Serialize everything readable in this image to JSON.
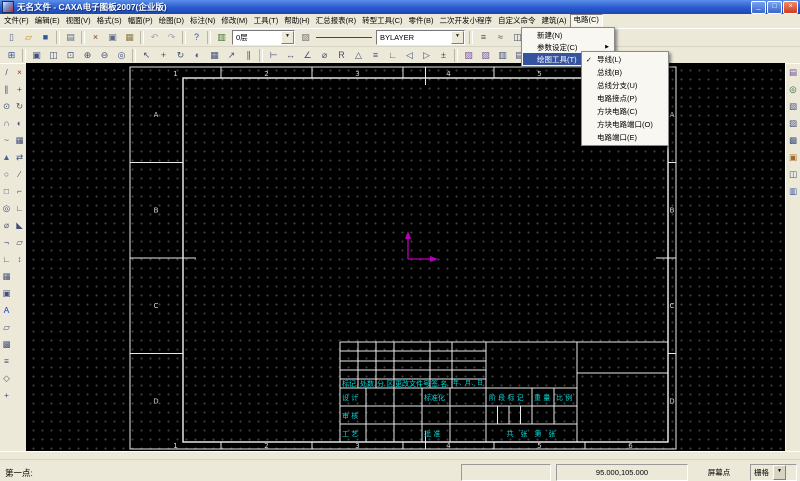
{
  "window": {
    "title": "无名文件 - CAXA电子图板2007(企业版)",
    "controls": [
      {
        "n": "minimize-button",
        "g": "_"
      },
      {
        "n": "maximize-button",
        "g": "□"
      },
      {
        "n": "close-button",
        "g": "×"
      }
    ]
  },
  "menubar": {
    "items": [
      "文件(F)",
      "编辑(E)",
      "视图(V)",
      "格式(S)",
      "幅面(P)",
      "绘图(D)",
      "标注(N)",
      "修改(M)",
      "工具(T)",
      "帮助(H)",
      "汇总报表(R)",
      "转型工具(C)",
      "零件(B)",
      "二次开发小程序",
      "自定义命令",
      "建筑(A)",
      "电路(C)"
    ],
    "open_index": 16
  },
  "toolbar1": {
    "layer_value": "0层",
    "linetype_value": "BYLAYER"
  },
  "icons": {
    "main_a": [
      {
        "n": "new-file-icon",
        "g": "▯",
        "c": "#5a6b8c"
      },
      {
        "n": "open-file-icon",
        "g": "▱",
        "c": "#c09018"
      },
      {
        "n": "save-icon",
        "g": "■",
        "c": "#34549c"
      },
      {
        "sep": true
      },
      {
        "n": "print-icon",
        "g": "▤",
        "c": "#5a6b8c"
      },
      {
        "sep": true
      },
      {
        "n": "cut-icon",
        "g": "×",
        "c": "#8c3030"
      },
      {
        "n": "copy-icon",
        "g": "▣",
        "c": "#5a6b8c"
      },
      {
        "n": "paste-icon",
        "g": "▦",
        "c": "#8a7b4a"
      },
      {
        "sep": true
      },
      {
        "n": "undo-icon",
        "g": "↶",
        "c": "#a0a4b0"
      },
      {
        "n": "redo-icon",
        "g": "↷",
        "c": "#a0a4b0"
      },
      {
        "sep": true
      },
      {
        "n": "help-icon",
        "g": "?",
        "c": "#2a52be"
      },
      {
        "sep": true
      },
      {
        "n": "layer-manager-icon",
        "g": "▥",
        "c": "#44702e"
      }
    ],
    "main_b": [
      {
        "sep": true
      },
      {
        "n": "linewidth-icon",
        "g": "≡",
        "c": "#445066"
      },
      {
        "n": "linetype-load-icon",
        "g": "≈",
        "c": "#445066"
      },
      {
        "n": "block-tool-icon",
        "g": "◫",
        "c": "#445066"
      },
      {
        "n": "image-insert-icon",
        "g": "▧",
        "c": "#c07820"
      }
    ],
    "standard2": [
      {
        "n": "frame-settings-icon",
        "g": "⊞",
        "c": "#34549c"
      },
      {
        "sep": true
      },
      {
        "n": "zoom-window-icon",
        "g": "▣"
      },
      {
        "n": "zoom-prev-icon",
        "g": "◫"
      },
      {
        "n": "zoom-all-icon",
        "g": "⊡"
      },
      {
        "n": "zoom-in-icon",
        "g": "⊕"
      },
      {
        "n": "zoom-out-icon",
        "g": "⊖"
      },
      {
        "n": "redraw-icon",
        "g": "◎"
      },
      {
        "sep": true
      },
      {
        "n": "pick-icon",
        "g": "↖"
      },
      {
        "n": "move-icon",
        "g": "+"
      },
      {
        "n": "rotate-icon",
        "g": "↻"
      },
      {
        "n": "mirror-icon",
        "g": "◐"
      },
      {
        "n": "array-icon",
        "g": "▦"
      },
      {
        "n": "scale-icon",
        "g": "↗"
      },
      {
        "n": "offset-icon",
        "g": "∥"
      },
      {
        "sep": true
      },
      {
        "n": "dim-linear-icon",
        "g": "⊢"
      },
      {
        "n": "dim-horizontal-icon",
        "g": "↔"
      },
      {
        "n": "dim-angle-icon",
        "g": "∠"
      },
      {
        "n": "dim-diameter-icon",
        "g": "⌀"
      },
      {
        "n": "dim-radius-icon",
        "g": "R"
      },
      {
        "n": "tolerance-icon",
        "g": "△"
      },
      {
        "n": "text-style-icon",
        "g": "≡"
      },
      {
        "n": "leader-icon",
        "g": "∟"
      },
      {
        "n": "datum-left-icon",
        "g": "◁"
      },
      {
        "n": "datum-right-icon",
        "g": "▷"
      },
      {
        "n": "deviation-icon",
        "g": "±"
      },
      {
        "sep": true
      },
      {
        "n": "hatch-icon",
        "g": "▨",
        "c": "#7a5aa0"
      },
      {
        "n": "solid-fill-icon",
        "g": "▧",
        "c": "#7a5aa0"
      },
      {
        "n": "table-icon",
        "g": "▥"
      },
      {
        "n": "bom-icon",
        "g": "▤"
      },
      {
        "n": "block-insert-icon",
        "g": "◇"
      },
      {
        "n": "library-icon",
        "g": "▩",
        "c": "#a06a2a"
      },
      {
        "n": "ole-object-icon",
        "g": "▬",
        "c": "#a06a2a"
      }
    ],
    "draw": [
      {
        "n": "line-icon",
        "g": "/"
      },
      {
        "n": "parallel-line-icon",
        "g": "∥"
      },
      {
        "n": "circle-icon",
        "g": "⊙"
      },
      {
        "n": "arc-icon",
        "g": "∩"
      },
      {
        "n": "spline-icon",
        "g": "~"
      },
      {
        "n": "polygon-icon",
        "g": "▲",
        "c": "#3a6aa0"
      },
      {
        "n": "ellipse-icon",
        "g": "○"
      },
      {
        "n": "rectangle-icon",
        "g": "□"
      },
      {
        "n": "center-line-icon",
        "g": "◎"
      },
      {
        "n": "hole-icon",
        "g": "⌀"
      },
      {
        "n": "polyline-icon",
        "g": "¬"
      },
      {
        "n": "contour-icon",
        "g": "∟"
      },
      {
        "n": "hatch-fill-icon",
        "g": "▦"
      },
      {
        "n": "block-create-icon",
        "g": "▣"
      },
      {
        "n": "text-icon",
        "g": "A",
        "c": "#1a3fbf"
      },
      {
        "n": "detail-view-icon",
        "g": "▱"
      },
      {
        "n": "grid-draw-icon",
        "g": "▩"
      },
      {
        "n": "formula-icon",
        "g": "≡"
      },
      {
        "n": "point-icon",
        "g": "◇"
      },
      {
        "n": "axis-icon",
        "g": "+"
      }
    ],
    "modify": [
      {
        "n": "delete-icon",
        "g": "×",
        "c": "#a03030"
      },
      {
        "n": "translate-icon",
        "g": "+"
      },
      {
        "n": "rotate-tool-icon",
        "g": "↻"
      },
      {
        "n": "mirror-tool-icon",
        "g": "◐"
      },
      {
        "n": "array-tool-icon",
        "g": "▦"
      },
      {
        "n": "stretch-icon",
        "g": "⇄"
      },
      {
        "n": "trim-icon",
        "g": "∕"
      },
      {
        "n": "corner-icon",
        "g": "⌐"
      },
      {
        "n": "chamfer-icon",
        "g": "∟"
      },
      {
        "n": "break-icon",
        "g": "◣"
      },
      {
        "n": "explode-icon",
        "g": "▱"
      },
      {
        "n": "extend-icon",
        "g": "↕"
      }
    ],
    "plugin": [
      {
        "n": "symbol-library-icon",
        "g": "▤",
        "c": "#6a4aa0"
      },
      {
        "n": "circuit-wire-icon",
        "g": "◎",
        "c": "#2a6a3a"
      },
      {
        "n": "bus-tool-icon",
        "g": "▧"
      },
      {
        "n": "node-tool-icon",
        "g": "▨"
      },
      {
        "n": "block-port-icon",
        "g": "▩"
      },
      {
        "n": "bom-export-icon",
        "g": "▣",
        "c": "#a06a2a"
      },
      {
        "n": "frame-fill-icon",
        "g": "◫"
      },
      {
        "n": "plugin-settings-icon",
        "g": "▥",
        "c": "#34549c"
      }
    ]
  },
  "circuit_menu": {
    "items": [
      {
        "label": "新建(N)"
      },
      {
        "label": "参数设定(C)",
        "arrow": true
      },
      {
        "label": "绘图工具(T)",
        "arrow": true,
        "hl": true
      }
    ]
  },
  "draw_tools_submenu": {
    "items": [
      {
        "label": "导线(L)",
        "check": true
      },
      {
        "label": "总线(B)"
      },
      {
        "label": "总线分支(U)"
      },
      {
        "label": "电路接点(P)"
      },
      {
        "label": "方块电路(C)"
      },
      {
        "label": "方块电路端口(O)"
      },
      {
        "label": "电路端口(E)"
      }
    ]
  },
  "drawing": {
    "zone_numbers": [
      "1",
      "2",
      "3",
      "4",
      "5",
      "6"
    ],
    "zone_letters": [
      "A",
      "B",
      "C",
      "D"
    ],
    "title_block": {
      "mark": "标记",
      "count": "处数",
      "zone": "分 区",
      "change_doc": "更改文件号",
      "sign": "签 名",
      "date": "年、月、日",
      "design": "设 计",
      "standard": "标准化",
      "review": "审 核",
      "craft": "工 艺",
      "approve": "批 准",
      "stage_mark": "阶 段 标 记",
      "weight": "重 量",
      "scale": "比 例",
      "sheets": "共　张　第　张"
    },
    "colors": {
      "frame": "#e9e9e9",
      "tb_text": "#00dcdc",
      "origin": "#b800b8",
      "grid_dot": "#424242",
      "background": "#000000"
    }
  },
  "statusbar": {
    "prompt": "第一点:",
    "coords": "95.000,105.000",
    "point_type": "屏幕点",
    "snap_mode": "栅格"
  }
}
